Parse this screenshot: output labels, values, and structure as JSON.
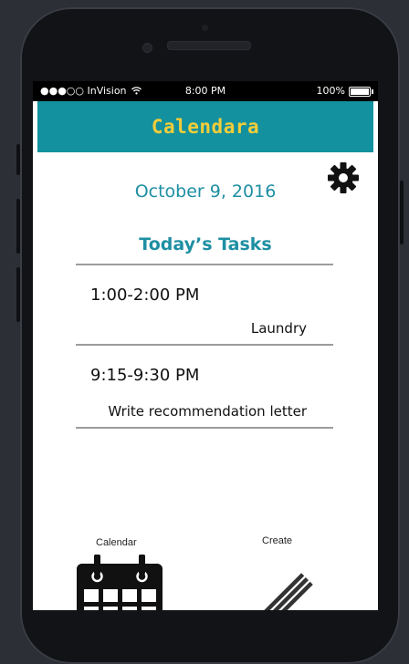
{
  "statusbar": {
    "carrier": "●●●○○ InVision",
    "time": "8:00 PM",
    "battery": "100%"
  },
  "header": {
    "title": "Calendara"
  },
  "main": {
    "date": "October 9, 2016",
    "tasks_heading": "Today’s Tasks",
    "tasks": [
      {
        "time": "1:00-2:00 PM",
        "description": "Laundry"
      },
      {
        "time": "9:15-9:30 PM",
        "description": "Write recommendation letter"
      }
    ]
  },
  "nav": {
    "calendar_label": "Calendar",
    "create_label": "Create"
  },
  "colors": {
    "header_bg": "#13919f",
    "title_text": "#f2cd3a",
    "accent_text": "#1e8fa3"
  }
}
